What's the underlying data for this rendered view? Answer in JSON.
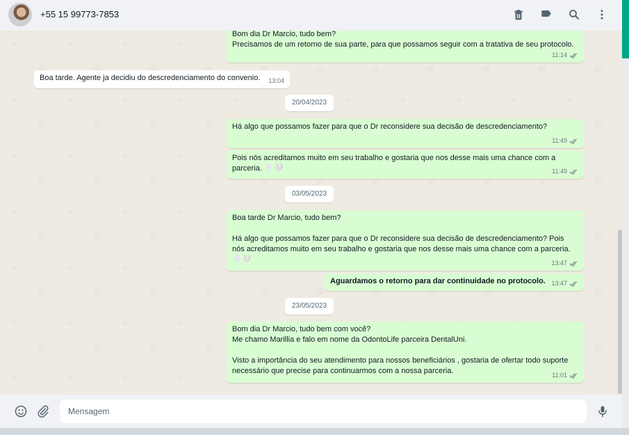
{
  "header": {
    "contact_name": "+55 15 99773-7853",
    "icons": [
      "delete-icon",
      "label-icon",
      "search-icon",
      "more-vert-icon"
    ]
  },
  "messages": [
    {
      "dir": "out",
      "text": "Bom dia Dr Marcio, tudo bem?\nPrecisamos de um retorno de sua parte, para que possamos seguir com a tratativa de seu protocolo.",
      "time": "11:14"
    },
    {
      "dir": "in",
      "text": "Boa tarde. Agente ja decidiu do descredenciamento do convenio.",
      "time": "13:04"
    },
    {
      "type": "date",
      "text": "20/04/2023"
    },
    {
      "dir": "out",
      "text": "Há algo que possamos fazer para que o Dr reconsidere sua decisão de descredenciamento?",
      "time": "11:49"
    },
    {
      "dir": "out",
      "text": "Pois nós acreditamos muito em seu trabalho e gostaria que nos desse mais uma chance com a parceria. 🦷🤍",
      "time": "11:49"
    },
    {
      "type": "date",
      "text": "03/05/2023"
    },
    {
      "dir": "out",
      "text": "Boa tarde Dr Marcio, tudo bem?\n\nHá algo que possamos fazer para que o Dr reconsidere sua decisão de descredenciamento? Pois nós acreditamos muito em seu trabalho e gostaria que nos desse mais uma chance com a parceria. 🦷🤍",
      "time": "13:47"
    },
    {
      "dir": "out",
      "text": "Aguardamos o retorno para dar continuidade no protocolo.",
      "time": "13:47",
      "bold": true
    },
    {
      "type": "date",
      "text": "23/05/2023"
    },
    {
      "dir": "out",
      "text": "Bom dia Dr Marcio, tudo bem com você?\nMe chamo Marillia e falo em nome da OdontoLife parceira DentalUni.\n\nVisto a importância do seu atendimento para nossos beneficiários , gostaria de ofertar todo suporte necessário que precise para continuarmos com a nossa parceria.",
      "time": "11:01"
    }
  ],
  "composer": {
    "placeholder": "Mensagem",
    "value": "",
    "icons": [
      "emoji-icon",
      "attach-icon",
      "mic-icon"
    ]
  },
  "colors": {
    "outgoing_bubble": "#d9fdd3",
    "incoming_bubble": "#ffffff",
    "chat_background": "#efeae2",
    "accent": "#00a884"
  }
}
